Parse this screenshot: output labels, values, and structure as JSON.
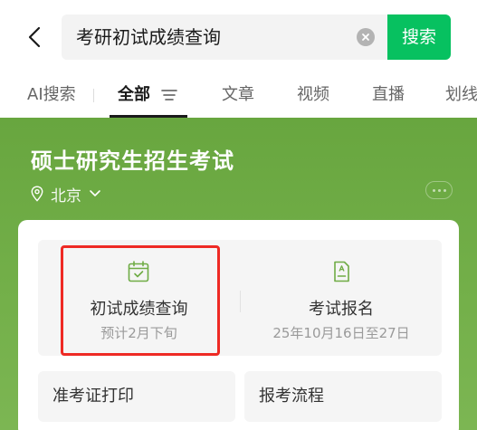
{
  "search": {
    "query": "考研初试成绩查询",
    "button_label": "搜索"
  },
  "tabs": [
    {
      "label": "AI搜索",
      "active": false
    },
    {
      "label": "全部",
      "active": true
    },
    {
      "label": "文章",
      "active": false
    },
    {
      "label": "视频",
      "active": false
    },
    {
      "label": "直播",
      "active": false
    },
    {
      "label": "划线",
      "active": false
    }
  ],
  "card": {
    "title": "硕士研究生招生考试",
    "location": "北京",
    "theme_color": "#6fac45",
    "services": [
      {
        "title": "初试成绩查询",
        "subtitle": "预计2月下旬",
        "icon": "calendar-check-icon",
        "highlighted": true
      },
      {
        "title": "考试报名",
        "subtitle": "25年10月16日至27日",
        "icon": "document-icon",
        "highlighted": false
      }
    ],
    "quick_links": [
      {
        "label": "准考证打印"
      },
      {
        "label": "报考流程"
      }
    ]
  },
  "colors": {
    "accent": "#07c160",
    "highlight": "#ee2a24"
  }
}
